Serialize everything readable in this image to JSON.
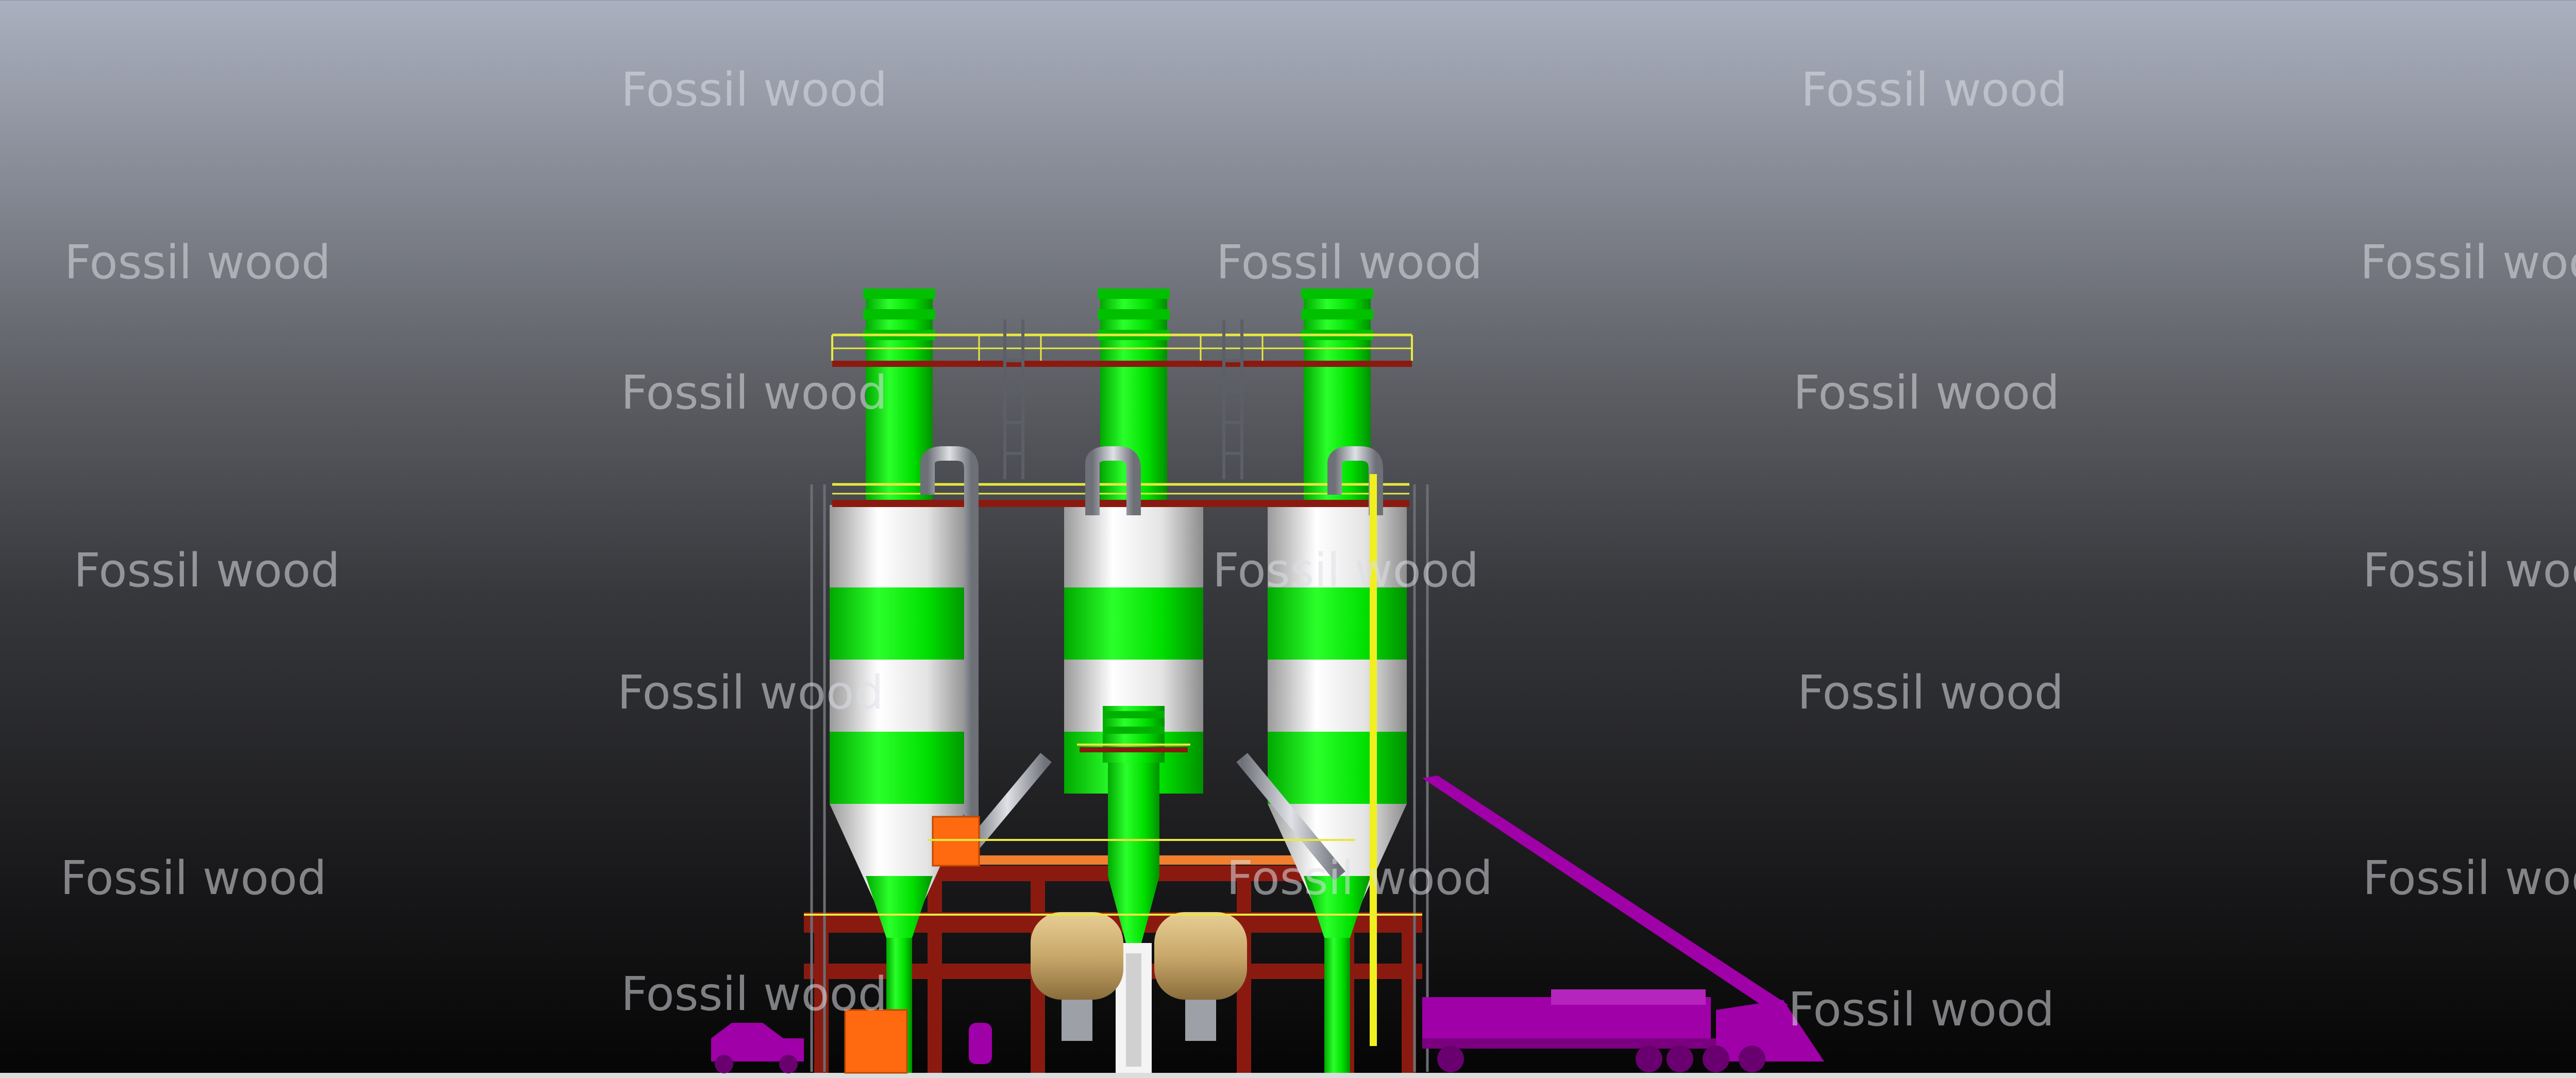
{
  "watermark": {
    "text": "Fossil wood",
    "color": "#dcdee4"
  },
  "scene": {
    "subject": "industrial-mixing-plant-3d-render",
    "silo_count": 3,
    "colors": {
      "silo_green": "#00ee00",
      "silo_white": "#f2f2f2",
      "steel_frame": "#8a1a10",
      "railing": "#e8e840",
      "truck": "#a000a8",
      "pipe": "#b9bcc2",
      "tank": "#c9a86a",
      "crate": "#ff6a10"
    }
  }
}
